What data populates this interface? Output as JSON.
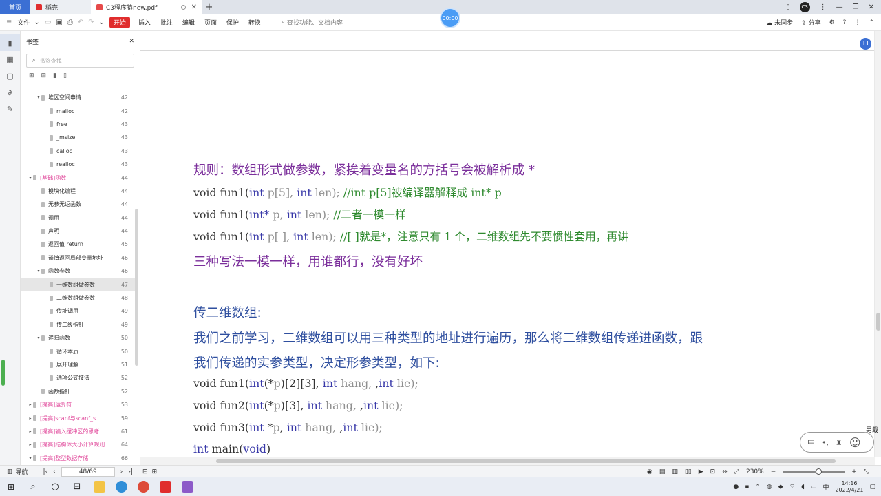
{
  "tabs": {
    "home": "首页",
    "doke": "稻壳",
    "file": "C3程序猿new.pdf"
  },
  "timer": "00:00",
  "window": {
    "avatar": "C3"
  },
  "menu": {
    "file": "文件",
    "start": "开始",
    "items": [
      "插入",
      "批注",
      "编辑",
      "页面",
      "保护",
      "转换"
    ],
    "search": "查找功能、文档内容",
    "sync": "未同步",
    "share": "分享"
  },
  "sidebar": {
    "title": "书签",
    "search_placeholder": "书签查找",
    "bookmarks": [
      {
        "label": "堆区空间申请",
        "page": "42",
        "level": 1,
        "expand": "▾",
        "pink": false
      },
      {
        "label": "malloc",
        "page": "42",
        "level": 2,
        "expand": "",
        "pink": false
      },
      {
        "label": "free",
        "page": "43",
        "level": 2,
        "expand": "",
        "pink": false
      },
      {
        "label": "_msize",
        "page": "43",
        "level": 2,
        "expand": "",
        "pink": false
      },
      {
        "label": "calloc",
        "page": "43",
        "level": 2,
        "expand": "",
        "pink": false
      },
      {
        "label": "realloc",
        "page": "43",
        "level": 2,
        "expand": "",
        "pink": false
      },
      {
        "label": "[基础]函数",
        "page": "44",
        "level": 0,
        "expand": "▾",
        "pink": true
      },
      {
        "label": "模块化编程",
        "page": "44",
        "level": 1,
        "expand": "",
        "pink": false
      },
      {
        "label": "无参无返函数",
        "page": "44",
        "level": 1,
        "expand": "",
        "pink": false
      },
      {
        "label": "调用",
        "page": "44",
        "level": 1,
        "expand": "",
        "pink": false
      },
      {
        "label": "声明",
        "page": "44",
        "level": 1,
        "expand": "",
        "pink": false
      },
      {
        "label": "返回值 return",
        "page": "45",
        "level": 1,
        "expand": "",
        "pink": false
      },
      {
        "label": "谨慎返回局部变量地址",
        "page": "46",
        "level": 1,
        "expand": "",
        "pink": false
      },
      {
        "label": "函数参数",
        "page": "46",
        "level": 1,
        "expand": "▾",
        "pink": false
      },
      {
        "label": "一维数组做参数",
        "page": "47",
        "level": 2,
        "expand": "",
        "pink": false,
        "selected": true
      },
      {
        "label": "二维数组做参数",
        "page": "48",
        "level": 2,
        "expand": "",
        "pink": false
      },
      {
        "label": "传址调用",
        "page": "49",
        "level": 2,
        "expand": "",
        "pink": false
      },
      {
        "label": "传二级指针",
        "page": "49",
        "level": 2,
        "expand": "",
        "pink": false
      },
      {
        "label": "递归函数",
        "page": "50",
        "level": 1,
        "expand": "▾",
        "pink": false
      },
      {
        "label": "循环本质",
        "page": "50",
        "level": 2,
        "expand": "",
        "pink": false
      },
      {
        "label": "展开理解",
        "page": "51",
        "level": 2,
        "expand": "",
        "pink": false
      },
      {
        "label": "通项公式技法",
        "page": "52",
        "level": 2,
        "expand": "",
        "pink": false
      },
      {
        "label": "函数指针",
        "page": "52",
        "level": 1,
        "expand": "",
        "pink": false
      },
      {
        "label": "[提高]运算符",
        "page": "53",
        "level": 0,
        "expand": "▸",
        "pink": true
      },
      {
        "label": "[提高]scanf与scanf_s",
        "page": "59",
        "level": 0,
        "expand": "▸",
        "pink": true
      },
      {
        "label": "[提高]输入缓冲区的思考",
        "page": "61",
        "level": 0,
        "expand": "▸",
        "pink": true
      },
      {
        "label": "[提高]结构体大小计算规则",
        "page": "64",
        "level": 0,
        "expand": "▸",
        "pink": true
      },
      {
        "label": "[提高]整型数据存储",
        "page": "66",
        "level": 0,
        "expand": "▾",
        "pink": true
      }
    ]
  },
  "doc": {
    "rule_heading": "规则：数组形式做参数，紧挨着变量名的方括号会被解析成 *",
    "code1": {
      "a": "void fun1(",
      "b": "int",
      "c": " p[5], ",
      "d": "int",
      "e": " len); ",
      "f": "//int p[5]被编译器解释成 int* p"
    },
    "code2": {
      "a": "void fun1(",
      "b": "int*",
      "c": " p, ",
      "d": "int",
      "e": " len);   ",
      "f": "//二者一模一样"
    },
    "code3": {
      "a": "void fun1(",
      "b": "int",
      "c": " p[ ], ",
      "d": "int",
      "e": " len); ",
      "f": "//[ ]就是*，注意只有 1 个，二维数组先不要惯性套用，再讲"
    },
    "three_ways": "三种写法一模一样，用谁都行，没有好坏",
    "sub_heading": "传二维数组:",
    "para1": "我们之前学习，二维数组可以用三种类型的地址进行遍历，那么将二维数组传递进函数，跟",
    "para2": "我们传递的实参类型，决定形参类型，如下:",
    "code4": {
      "a": "void fun1(",
      "b": "int",
      "c": "(*",
      "d": "p",
      "e": ")[2][3], ",
      "f": "int",
      "g": " hang, ",
      "h": "int",
      "i": " lie);"
    },
    "code5": {
      "a": "void fun2(",
      "b": "int",
      "c": "(*",
      "d": "p",
      "e": ")[3], ",
      "f": "int",
      "g": " hang, ",
      "h": "int",
      "i": " lie);"
    },
    "code6": {
      "a": "void fun3(",
      "b": "int",
      "c": " *",
      "d": "p",
      "e": ", ",
      "f": "int",
      "g": " hang, ",
      "h": "int",
      "i": " lie);"
    },
    "code7": {
      "a": "int",
      "b": " main(",
      "c": "void",
      "d": ")"
    }
  },
  "widget": {
    "ime": "中",
    "corner_text": "另戴"
  },
  "status": {
    "nav": "导航",
    "page": "48/69",
    "zoom": "230%"
  },
  "taskbar": {
    "time": "14:16",
    "date": "2022/4/21"
  },
  "colors": {
    "accent": "#3b6fd4",
    "start": "#e02d2d",
    "heading_purple": "#7b2f9b",
    "heading_blue": "#2f4f9f",
    "keyword": "#3838a8",
    "comment": "#2f8a2f"
  }
}
